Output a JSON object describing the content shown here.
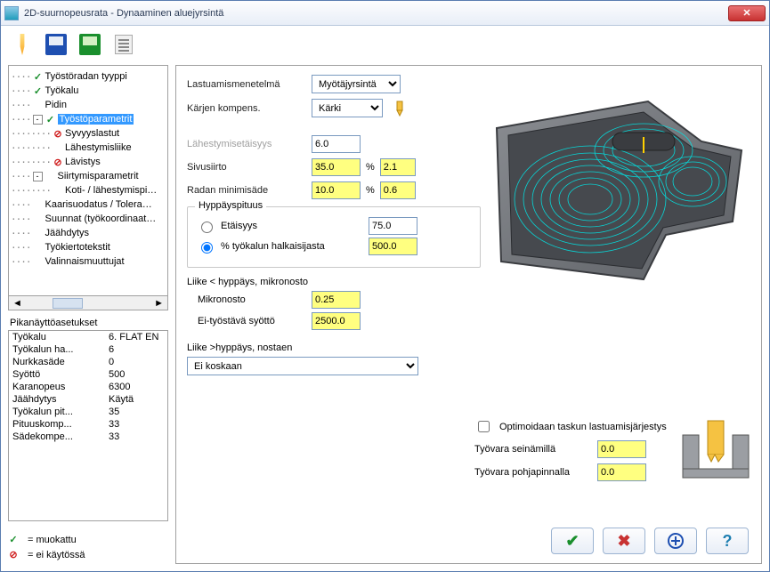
{
  "window": {
    "title": "2D-suurnopeusrata - Dynaaminen aluejyrsintä"
  },
  "tree": {
    "items": [
      {
        "indent": 1,
        "glyph": "chk",
        "label": "Työstöradan tyyppi"
      },
      {
        "indent": 1,
        "glyph": "chk",
        "label": "Työkalu"
      },
      {
        "indent": 1,
        "glyph": "",
        "label": "Pidin"
      },
      {
        "indent": 1,
        "glyph": "chk",
        "label": "Työstöparametrit",
        "expand": "-",
        "selected": true
      },
      {
        "indent": 2,
        "glyph": "forbid",
        "label": "Syvyyslastut"
      },
      {
        "indent": 2,
        "glyph": "",
        "label": "Lähestymisliike"
      },
      {
        "indent": 2,
        "glyph": "forbid",
        "label": "Lävistys"
      },
      {
        "indent": 1,
        "glyph": "",
        "label": "Siirtymisparametrit",
        "expand": "-"
      },
      {
        "indent": 2,
        "glyph": "",
        "label": "Koti- / lähestymispi…"
      },
      {
        "indent": 1,
        "glyph": "",
        "label": "Kaarisuodatus / Tolera…"
      },
      {
        "indent": 1,
        "glyph": "",
        "label": "Suunnat (työkoordinaat…"
      },
      {
        "indent": 1,
        "glyph": "",
        "label": "Jäähdytys"
      },
      {
        "indent": 1,
        "glyph": "",
        "label": "Työkiertotekstit"
      },
      {
        "indent": 1,
        "glyph": "",
        "label": "Valinnaismuuttujat"
      }
    ]
  },
  "quickview": {
    "title": "Pikanäyttöasetukset",
    "rows": [
      {
        "k": "Työkalu",
        "v": "6. FLAT EN"
      },
      {
        "k": "Työkalun ha...",
        "v": "6"
      },
      {
        "k": "Nurkkasäde",
        "v": "0"
      },
      {
        "k": "Syöttö",
        "v": "500"
      },
      {
        "k": "Karanopeus",
        "v": "6300"
      },
      {
        "k": "Jäähdytys",
        "v": "Käytä"
      },
      {
        "k": "Työkalun pit...",
        "v": "35"
      },
      {
        "k": "Pituuskomp...",
        "v": "33"
      },
      {
        "k": "Sädekompe...",
        "v": "33"
      }
    ]
  },
  "legend": {
    "modified": "= muokattu",
    "disabled": "= ei käytössä"
  },
  "form": {
    "method_label": "Lastuamismenetelmä",
    "method_value": "Myötäjyrsintä",
    "comp_label": "Kärjen kompens.",
    "comp_value": "Kärki",
    "approach_label": "Lähestymisetäisyys",
    "approach_value": "6.0",
    "stepover_label": "Sivusiirto",
    "stepover_pct": "35.0",
    "stepover_abs": "2.1",
    "minrad_label": "Radan minimisäde",
    "minrad_pct": "10.0",
    "minrad_abs": "0.6",
    "pct_sign": "%",
    "jump_group": "Hyppäyspituus",
    "jump_dist": "Etäisyys",
    "jump_dist_val": "75.0",
    "jump_pct": "% työkalun halkaisijasta",
    "jump_pct_val": "500.0",
    "micro_group": "Liike < hyppäys, mikronosto",
    "micro_label": "Mikronosto",
    "micro_val": "0.25",
    "nonwork_label": "Ei-työstävä syöttö",
    "nonwork_val": "2500.0",
    "lift_label": "Liike >hyppäys, nostaen",
    "lift_value": "Ei koskaan",
    "optimize": "Optimoidaan taskun lastuamisjärjestys",
    "wall_label": "Työvara seinämillä",
    "wall_val": "0.0",
    "floor_label": "Työvara pohjapinnalla",
    "floor_val": "0.0"
  }
}
